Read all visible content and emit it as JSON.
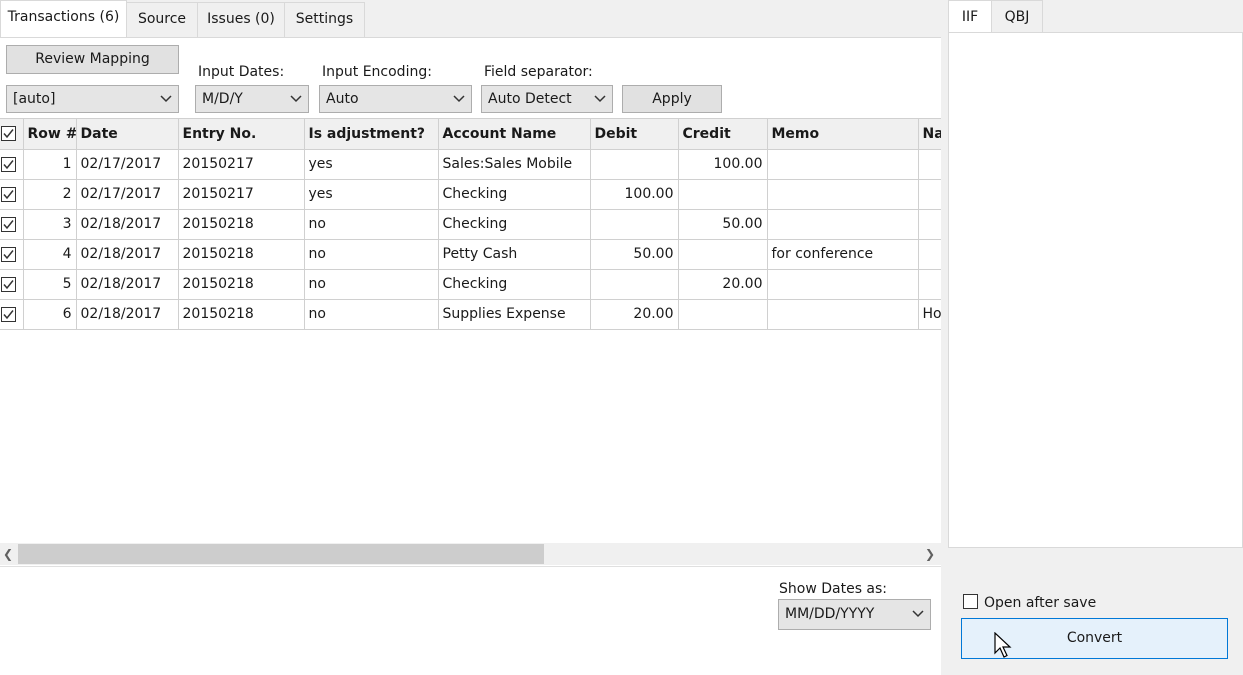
{
  "tabs": [
    "Transactions (6)",
    "Source",
    "Issues (0)",
    "Settings"
  ],
  "toolbar": {
    "review_mapping": "Review Mapping",
    "mapping_select": "[auto]",
    "input_dates_label": "Input Dates:",
    "input_dates_value": "M/D/Y",
    "input_encoding_label": "Input Encoding:",
    "input_encoding_value": "Auto",
    "field_separator_label": "Field separator:",
    "field_separator_value": "Auto Detect",
    "apply": "Apply"
  },
  "grid": {
    "headers": [
      "Row #",
      "Date",
      "Entry No.",
      "Is adjustment?",
      "Account Name",
      "Debit",
      "Credit",
      "Memo",
      "Na"
    ],
    "rows": [
      {
        "row": "1",
        "date": "02/17/2017",
        "entry": "20150217",
        "adj": "yes",
        "account": "Sales:Sales Mobile",
        "debit": "",
        "credit": "100.00",
        "memo": "",
        "name": ""
      },
      {
        "row": "2",
        "date": "02/17/2017",
        "entry": "20150217",
        "adj": "yes",
        "account": "Checking",
        "debit": "100.00",
        "credit": "",
        "memo": "",
        "name": ""
      },
      {
        "row": "3",
        "date": "02/18/2017",
        "entry": "20150218",
        "adj": "no",
        "account": "Checking",
        "debit": "",
        "credit": "50.00",
        "memo": "",
        "name": ""
      },
      {
        "row": "4",
        "date": "02/18/2017",
        "entry": "20150218",
        "adj": "no",
        "account": "Petty Cash",
        "debit": "50.00",
        "credit": "",
        "memo": "for conference",
        "name": ""
      },
      {
        "row": "5",
        "date": "02/18/2017",
        "entry": "20150218",
        "adj": "no",
        "account": "Checking",
        "debit": "",
        "credit": "20.00",
        "memo": "",
        "name": ""
      },
      {
        "row": "6",
        "date": "02/18/2017",
        "entry": "20150218",
        "adj": "no",
        "account": "Supplies Expense",
        "debit": "20.00",
        "credit": "",
        "memo": "",
        "name": "Ho"
      }
    ]
  },
  "show_dates": {
    "label": "Show Dates as:",
    "value": "MM/DD/YYYY"
  },
  "right_panel": {
    "tabs": [
      "IIF",
      "QBJ"
    ],
    "open_after_save": "Open after save",
    "convert": "Convert"
  }
}
